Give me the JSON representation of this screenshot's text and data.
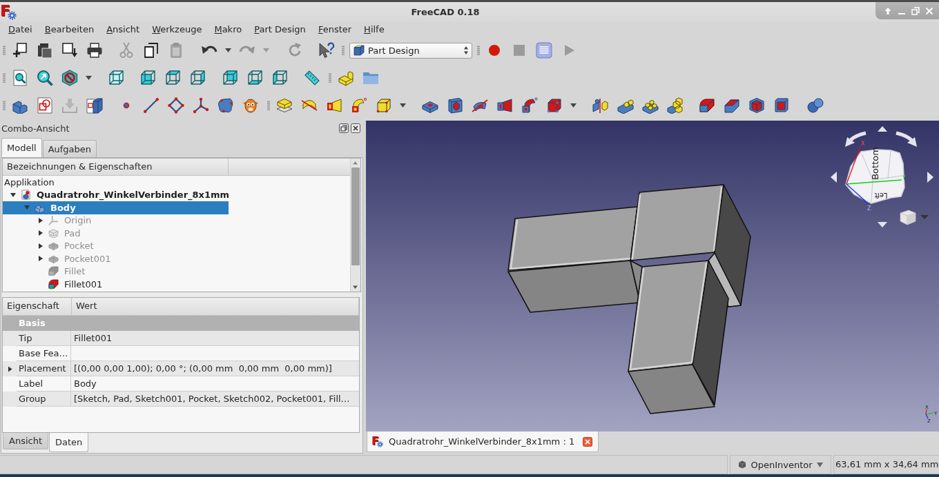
{
  "window": {
    "logo": "F",
    "title": "FreeCAD 0.18"
  },
  "menu": [
    "Datei",
    "Bearbeiten",
    "Ansicht",
    "Werkzeuge",
    "Makro",
    "Part Design",
    "Fenster",
    "Hilfe"
  ],
  "toolbars": {
    "file": {
      "buttons": [
        {
          "disabled": false
        },
        {
          "disabled": false
        },
        {
          "disabled": false
        },
        {
          "disabled": false
        },
        {
          "disabled": true
        },
        {
          "disabled": false
        },
        {
          "disabled": true
        },
        {
          "disabled": false,
          "menu": true
        },
        {
          "disabled": true,
          "menu": true
        },
        {
          "disabled": true
        },
        {
          "disabled": false
        }
      ]
    },
    "workbench": {
      "value": "Part Design"
    },
    "macro": {
      "buttons": [
        {
          "disabled": false
        },
        {
          "disabled": true
        },
        {
          "disabled": false
        },
        {
          "disabled": true
        }
      ]
    },
    "view": {
      "buttons": [
        {
          "disabled": false
        },
        {
          "disabled": false
        },
        {
          "disabled": false,
          "menu": true
        },
        {
          "disabled": false
        },
        {
          "disabled": false
        },
        {
          "disabled": false
        },
        {
          "disabled": false
        },
        {
          "disabled": false
        },
        {
          "disabled": false
        },
        {
          "disabled": false
        },
        {
          "disabled": false
        }
      ]
    },
    "structure": {
      "buttons": [
        {
          "disabled": false
        },
        {
          "disabled": false
        }
      ]
    },
    "helper": {
      "buttons": [
        {
          "disabled": false
        },
        {
          "disabled": false
        },
        {
          "disabled": true
        },
        {
          "disabled": false
        },
        {
          "disabled": false
        },
        {
          "disabled": false
        },
        {
          "disabled": false
        },
        {
          "disabled": false
        },
        {
          "disabled": false
        },
        {
          "disabled": false
        }
      ]
    },
    "modeling": {
      "buttons": [
        {
          "disabled": false
        },
        {
          "disabled": false
        },
        {
          "disabled": false
        },
        {
          "disabled": false
        },
        {
          "disabled": false,
          "menu": true
        },
        {
          "disabled": false
        },
        {
          "disabled": false
        },
        {
          "disabled": false
        },
        {
          "disabled": false
        },
        {
          "disabled": false
        },
        {
          "disabled": false,
          "menu": true
        },
        {
          "disabled": false
        },
        {
          "disabled": false
        },
        {
          "disabled": false
        },
        {
          "disabled": false
        },
        {
          "disabled": false
        },
        {
          "disabled": false
        },
        {
          "disabled": false
        },
        {
          "disabled": false
        },
        {
          "disabled": false
        }
      ]
    }
  },
  "combo_view": {
    "title": "Combo-Ansicht",
    "tabs": [
      {
        "label": "Modell",
        "selected": true
      },
      {
        "label": "Aufgaben",
        "selected": false
      }
    ],
    "tree": {
      "column": "Bezeichnungen & Eigenschaften",
      "root": "Applikation",
      "items": [
        {
          "label": "Quadratrohr_WinkelVerbinder_8x1mm",
          "kind": "document",
          "expanded": true,
          "selected": false,
          "hidden": false,
          "children": [
            {
              "label": "Body",
              "kind": "body",
              "expanded": true,
              "selected": true,
              "hidden": false,
              "children": [
                {
                  "label": "Origin",
                  "kind": "origin",
                  "expanded": false,
                  "selected": false,
                  "hidden": true,
                  "tip": false
                },
                {
                  "label": "Pad",
                  "kind": "pad",
                  "expanded": false,
                  "selected": false,
                  "hidden": true,
                  "tip": false
                },
                {
                  "label": "Pocket",
                  "kind": "pocket",
                  "expanded": false,
                  "selected": false,
                  "hidden": true,
                  "tip": false
                },
                {
                  "label": "Pocket001",
                  "kind": "pocket",
                  "expanded": false,
                  "selected": false,
                  "hidden": true,
                  "tip": false
                },
                {
                  "label": "Fillet",
                  "kind": "fillet",
                  "selected": false,
                  "hidden": true,
                  "tip": false
                },
                {
                  "label": "Fillet001",
                  "kind": "fillet",
                  "selected": false,
                  "hidden": false,
                  "tip": true
                }
              ]
            }
          ]
        }
      ]
    },
    "properties": {
      "columns": [
        "Eigenschaft",
        "Wert"
      ],
      "groups": [
        {
          "name": "Basis",
          "rows": [
            {
              "name": "Tip",
              "value": "Fillet001"
            },
            {
              "name": "Base Fea…"
            },
            {
              "name": "Placement",
              "value": "[(0,00 0,00 1,00); 0,00 °; (0,00 mm  0,00 mm  0,00 mm)]",
              "expanded": false
            },
            {
              "name": "Label",
              "value": "Body"
            },
            {
              "name": "Group",
              "value": "[Sketch, Pad, Sketch001, Pocket, Sketch002, Pocket001, Fill…"
            }
          ]
        }
      ]
    },
    "property_tabs": [
      {
        "label": "Ansicht",
        "selected": false
      },
      {
        "label": "Daten",
        "selected": true
      }
    ]
  },
  "viewport": {
    "nav_cube": {
      "face_labels": [
        "Bottom",
        "Left"
      ],
      "axis_labels": [
        "X",
        "Y",
        "Z"
      ]
    },
    "axis_triad": {
      "labels": [
        "X",
        "Y",
        "Z"
      ]
    }
  },
  "document_tabs": [
    {
      "logo": "F",
      "label": "Quadratrohr_WinkelVerbinder_8x1mm : 1",
      "selected": true
    }
  ],
  "status_bar": {
    "navigation_style": "OpenInventor",
    "dimensions": "63,61 mm x 34,64 mm"
  }
}
